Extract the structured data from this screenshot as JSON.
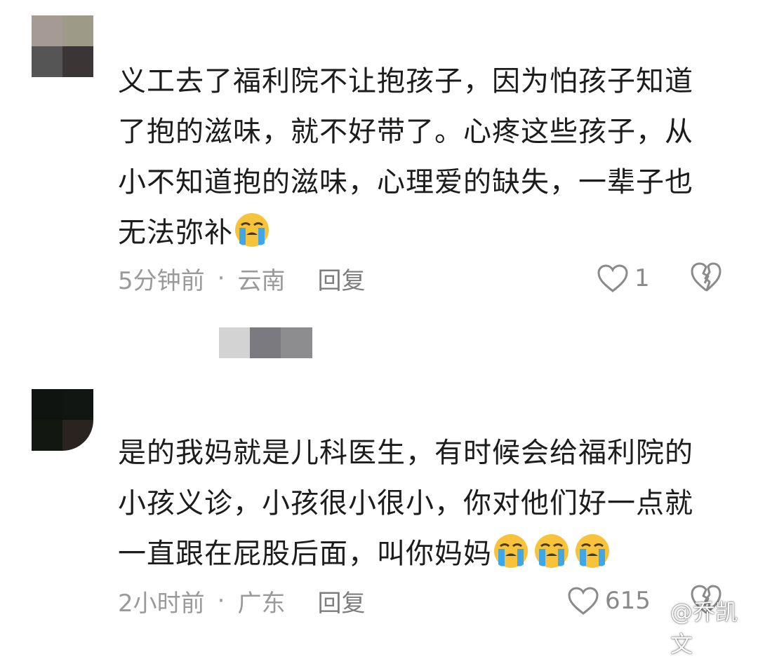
{
  "comments": [
    {
      "text": "义工去了福利院不让抱孩子，因为怕孩子知道了抱的滋味，就不好带了。心疼这些孩子，从小不知道抱的滋味，心理爱的缺失，一辈子也无法弥补",
      "emoji": [
        "loudly-crying-face"
      ],
      "time": "5分钟前",
      "separator": "·",
      "location": "云南",
      "reply_label": "回复",
      "likes": "1"
    },
    {
      "text": "是的我妈就是儿科医生，有时候会给福利院的小孩义诊，小孩很小很小，你对他们好一点就一直跟在屁股后面，叫你妈妈",
      "emoji": [
        "loudly-crying-face",
        "loudly-crying-face",
        "loudly-crying-face"
      ],
      "time": "2小时前",
      "separator": "·",
      "location": "广东",
      "reply_label": "回复",
      "likes": "615"
    }
  ],
  "watermark": {
    "text": "@乔凯文",
    "icon": "weibo-logo-icon"
  },
  "colors": {
    "text": "#1c1c1c",
    "meta": "#9a9a9a",
    "icon": "#8a8a8a",
    "emoji_face": "#f6c33b",
    "emoji_tears": "#3fa7e8"
  }
}
